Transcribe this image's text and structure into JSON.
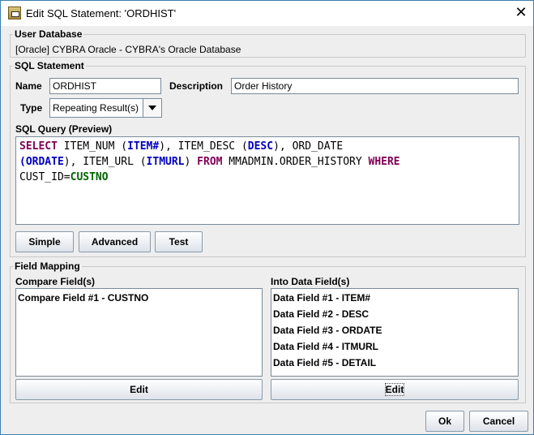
{
  "window": {
    "title": "Edit SQL Statement: 'ORDHIST'",
    "close_glyph": "✕"
  },
  "user_database": {
    "legend": "User Database",
    "value": "[Oracle] CYBRA Oracle - CYBRA's Oracle Database"
  },
  "sql_statement": {
    "legend": "SQL Statement",
    "name_label": "Name",
    "name_value": "ORDHIST",
    "description_label": "Description",
    "description_value": "Order History",
    "type_label": "Type",
    "type_value": "Repeating Result(s)",
    "query_label": "SQL Query (Preview)",
    "query": {
      "t1": "SELECT",
      "t2": " ITEM_NUM (",
      "t3": "ITEM#",
      "t4": "), ITEM_DESC (",
      "t5": "DESC",
      "t6": "), ORD_DATE",
      "t7": "(",
      "t8": "ORDATE",
      "t9": "), ITEM_URL (",
      "t10": "ITMURL",
      "t11": ") ",
      "t12": "FROM",
      "t13": " MMADMIN.ORDER_HISTORY ",
      "t14": "WHERE",
      "t15": "CUST_ID=",
      "t16": "CUSTNO"
    },
    "buttons": {
      "simple": "Simple",
      "advanced": "Advanced",
      "test": "Test"
    }
  },
  "field_mapping": {
    "legend": "Field Mapping",
    "compare_label": "Compare Field(s)",
    "compare_items": [
      "Compare Field #1 - CUSTNO"
    ],
    "into_label": "Into Data Field(s)",
    "into_items": [
      "Data Field #1 - ITEM#",
      "Data Field #2 - DESC",
      "Data Field #3 - ORDATE",
      "Data Field #4 - ITMURL",
      "Data Field #5 - DETAIL"
    ],
    "edit_compare_label": "Edit",
    "edit_into_label": "Edit"
  },
  "footer": {
    "ok_label": "Ok",
    "cancel_label": "Cancel"
  }
}
